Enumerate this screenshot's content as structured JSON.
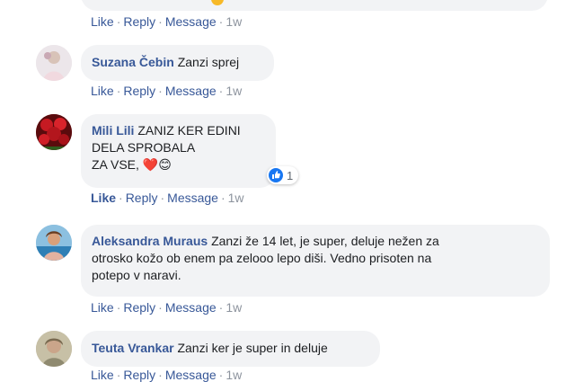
{
  "comments": [
    {
      "actions": {
        "like": "Like",
        "reply": "Reply",
        "message": "Message",
        "time": "1w"
      }
    },
    {
      "author": "Suzana Čebin",
      "text": "Zanzi sprej",
      "actions": {
        "like": "Like",
        "reply": "Reply",
        "message": "Message",
        "time": "1w"
      }
    },
    {
      "author": "Mili Lili",
      "text_line1": "ZANIZ KER EDINI",
      "text_line2": "DELA SPROBALA",
      "text_line3": "ZA VSE,",
      "emoji": "❤️😊",
      "reaction_count": "1",
      "actions": {
        "like": "Like",
        "reply": "Reply",
        "message": "Message",
        "time": "1w"
      }
    },
    {
      "author": "Aleksandra Muraus",
      "text_line1": "Zanzi že 14 let, je super, deluje nežen za",
      "text_line2": "otrosko kožo ob enem pa zelooo lepo diši. Vedno prisoten na",
      "text_line3": "potepo v naravi.",
      "actions": {
        "like": "Like",
        "reply": "Reply",
        "message": "Message",
        "time": "1w"
      }
    },
    {
      "author": "Teuta Vrankar",
      "text": "Zanzi ker je super in deluje",
      "actions": {
        "like": "Like",
        "reply": "Reply",
        "message": "Message",
        "time": "1w"
      }
    }
  ],
  "colors": {
    "link": "#385898",
    "bubble": "#f2f3f5",
    "meta": "#8d949e",
    "like_blue": "#1877f2"
  }
}
